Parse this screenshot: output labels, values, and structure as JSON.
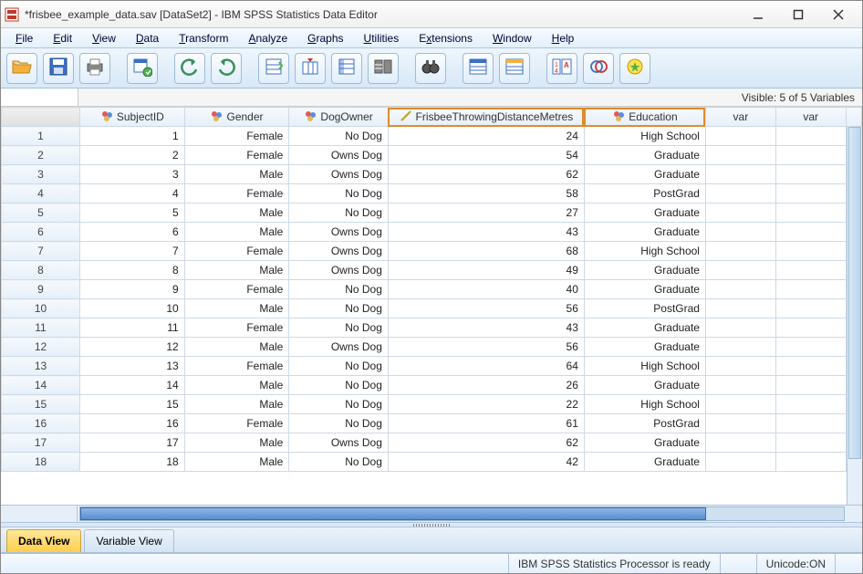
{
  "window": {
    "title": "*frisbee_example_data.sav [DataSet2] - IBM SPSS Statistics Data Editor"
  },
  "menu": {
    "file": "File",
    "edit": "Edit",
    "view": "View",
    "data": "Data",
    "transform": "Transform",
    "analyze": "Analyze",
    "graphs": "Graphs",
    "utilities": "Utilities",
    "extensions": "Extensions",
    "window": "Window",
    "help": "Help"
  },
  "info": {
    "visible": "Visible: 5 of 5 Variables"
  },
  "columns": {
    "subject": "SubjectID",
    "gender": "Gender",
    "dogowner": "DogOwner",
    "frisbee": "FrisbeeThrowingDistanceMetres",
    "education": "Education",
    "var": "var"
  },
  "rows": [
    {
      "n": "1",
      "subj": "1",
      "gender": "Female",
      "dog": "No Dog",
      "dist": "24",
      "edu": "High School"
    },
    {
      "n": "2",
      "subj": "2",
      "gender": "Female",
      "dog": "Owns Dog",
      "dist": "54",
      "edu": "Graduate"
    },
    {
      "n": "3",
      "subj": "3",
      "gender": "Male",
      "dog": "Owns Dog",
      "dist": "62",
      "edu": "Graduate"
    },
    {
      "n": "4",
      "subj": "4",
      "gender": "Female",
      "dog": "No Dog",
      "dist": "58",
      "edu": "PostGrad"
    },
    {
      "n": "5",
      "subj": "5",
      "gender": "Male",
      "dog": "No Dog",
      "dist": "27",
      "edu": "Graduate"
    },
    {
      "n": "6",
      "subj": "6",
      "gender": "Male",
      "dog": "Owns Dog",
      "dist": "43",
      "edu": "Graduate"
    },
    {
      "n": "7",
      "subj": "7",
      "gender": "Female",
      "dog": "Owns Dog",
      "dist": "68",
      "edu": "High School"
    },
    {
      "n": "8",
      "subj": "8",
      "gender": "Male",
      "dog": "Owns Dog",
      "dist": "49",
      "edu": "Graduate"
    },
    {
      "n": "9",
      "subj": "9",
      "gender": "Female",
      "dog": "No Dog",
      "dist": "40",
      "edu": "Graduate"
    },
    {
      "n": "10",
      "subj": "10",
      "gender": "Male",
      "dog": "No Dog",
      "dist": "56",
      "edu": "PostGrad"
    },
    {
      "n": "11",
      "subj": "11",
      "gender": "Female",
      "dog": "No Dog",
      "dist": "43",
      "edu": "Graduate"
    },
    {
      "n": "12",
      "subj": "12",
      "gender": "Male",
      "dog": "Owns Dog",
      "dist": "56",
      "edu": "Graduate"
    },
    {
      "n": "13",
      "subj": "13",
      "gender": "Female",
      "dog": "No Dog",
      "dist": "64",
      "edu": "High School"
    },
    {
      "n": "14",
      "subj": "14",
      "gender": "Male",
      "dog": "No Dog",
      "dist": "26",
      "edu": "Graduate"
    },
    {
      "n": "15",
      "subj": "15",
      "gender": "Male",
      "dog": "No Dog",
      "dist": "22",
      "edu": "High School"
    },
    {
      "n": "16",
      "subj": "16",
      "gender": "Female",
      "dog": "No Dog",
      "dist": "61",
      "edu": "PostGrad"
    },
    {
      "n": "17",
      "subj": "17",
      "gender": "Male",
      "dog": "Owns Dog",
      "dist": "62",
      "edu": "Graduate"
    },
    {
      "n": "18",
      "subj": "18",
      "gender": "Male",
      "dog": "No Dog",
      "dist": "42",
      "edu": "Graduate"
    }
  ],
  "tabs": {
    "data_view": "Data View",
    "variable_view": "Variable View"
  },
  "status": {
    "processor": "IBM SPSS Statistics Processor is ready",
    "unicode": "Unicode:ON"
  }
}
